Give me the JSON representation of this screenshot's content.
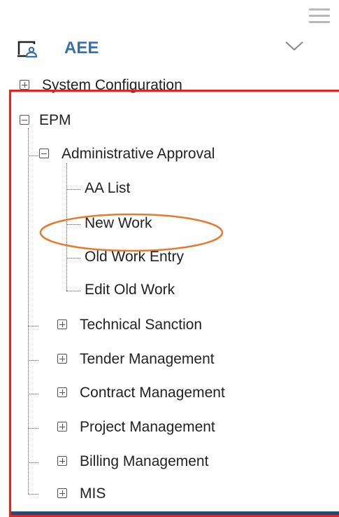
{
  "header": {
    "menu_icon": "hamburger-menu-icon"
  },
  "user": {
    "name": "AEE",
    "icon": "user-badge-icon",
    "expand_icon": "chevron-down-icon"
  },
  "tree": {
    "system_configuration": "System Configuration",
    "epm": "EPM",
    "administrative_approval": "Administrative Approval",
    "aa_list": "AA List",
    "new_work": "New Work",
    "old_work_entry": "Old Work Entry",
    "edit_old_work": "Edit Old Work",
    "technical_sanction": "Technical Sanction",
    "tender_management": "Tender Management",
    "contract_management": "Contract Management",
    "project_management": "Project Management",
    "billing_management": "Billing Management",
    "mis": "MIS"
  },
  "annotations": {
    "highlight_color": "#ff1a1a",
    "oval_color": "#e8782a"
  },
  "colors": {
    "accent": "#3a6fb0",
    "bottom_bar": "#1d4f7c"
  }
}
